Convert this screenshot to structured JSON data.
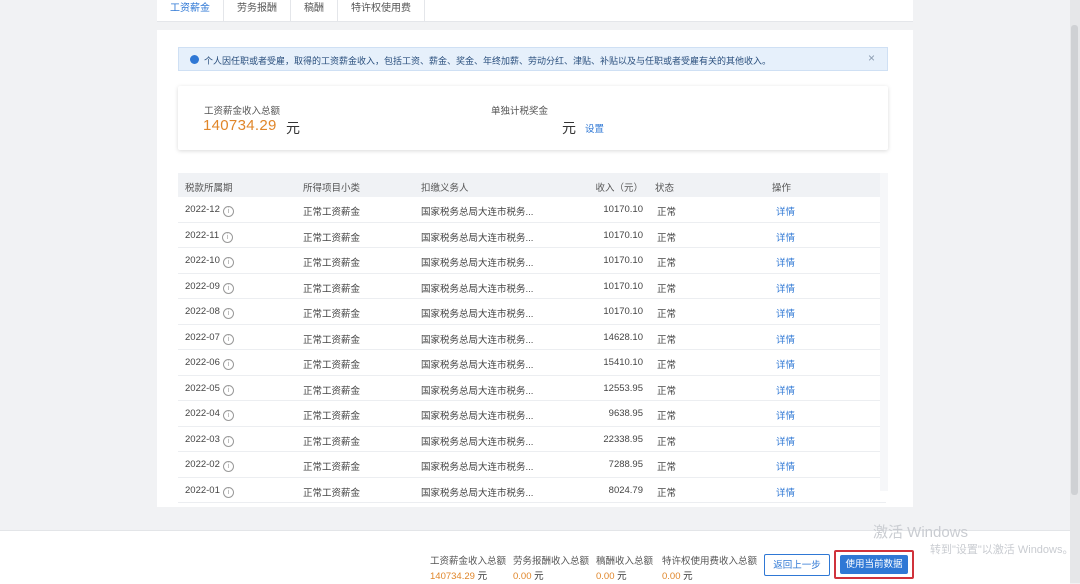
{
  "tabs": [
    "工资薪金",
    "劳务报酬",
    "稿酬",
    "特许权使用费"
  ],
  "notice": {
    "text": "个人因任职或者受雇，取得的工资薪金收入，包括工资、薪金、奖金、年终加薪、劳动分红、津贴、补贴以及与任职或者受雇有关的其他收入。",
    "close": "×"
  },
  "summary": {
    "total_label": "工资薪金收入总额",
    "total_value": "140734.29",
    "total_unit": "元",
    "bonus_label": "单独计税奖金",
    "bonus_unit": "元",
    "bonus_action": "设置"
  },
  "table": {
    "headers": [
      "税款所属期",
      "所得项目小类",
      "扣缴义务人",
      "收入（元）",
      "状态",
      "操作"
    ],
    "rows": [
      {
        "period": "2022-12",
        "item": "正常工资薪金",
        "payer": "国家税务总局大连市税务...",
        "income": "10170.10",
        "status": "正常",
        "op": "详情"
      },
      {
        "period": "2022-11",
        "item": "正常工资薪金",
        "payer": "国家税务总局大连市税务...",
        "income": "10170.10",
        "status": "正常",
        "op": "详情"
      },
      {
        "period": "2022-10",
        "item": "正常工资薪金",
        "payer": "国家税务总局大连市税务...",
        "income": "10170.10",
        "status": "正常",
        "op": "详情"
      },
      {
        "period": "2022-09",
        "item": "正常工资薪金",
        "payer": "国家税务总局大连市税务...",
        "income": "10170.10",
        "status": "正常",
        "op": "详情"
      },
      {
        "period": "2022-08",
        "item": "正常工资薪金",
        "payer": "国家税务总局大连市税务...",
        "income": "10170.10",
        "status": "正常",
        "op": "详情"
      },
      {
        "period": "2022-07",
        "item": "正常工资薪金",
        "payer": "国家税务总局大连市税务...",
        "income": "14628.10",
        "status": "正常",
        "op": "详情"
      },
      {
        "period": "2022-06",
        "item": "正常工资薪金",
        "payer": "国家税务总局大连市税务...",
        "income": "15410.10",
        "status": "正常",
        "op": "详情"
      },
      {
        "period": "2022-05",
        "item": "正常工资薪金",
        "payer": "国家税务总局大连市税务...",
        "income": "12553.95",
        "status": "正常",
        "op": "详情"
      },
      {
        "period": "2022-04",
        "item": "正常工资薪金",
        "payer": "国家税务总局大连市税务...",
        "income": "9638.95",
        "status": "正常",
        "op": "详情"
      },
      {
        "period": "2022-03",
        "item": "正常工资薪金",
        "payer": "国家税务总局大连市税务...",
        "income": "22338.95",
        "status": "正常",
        "op": "详情"
      },
      {
        "period": "2022-02",
        "item": "正常工资薪金",
        "payer": "国家税务总局大连市税务...",
        "income": "7288.95",
        "status": "正常",
        "op": "详情"
      },
      {
        "period": "2022-01",
        "item": "正常工资薪金",
        "payer": "国家税务总局大连市税务...",
        "income": "8024.79",
        "status": "正常",
        "op": "详情"
      }
    ]
  },
  "footer": {
    "items": [
      {
        "label": "工资薪金收入总额",
        "value": "140734.29",
        "unit": "元"
      },
      {
        "label": "劳务报酬收入总额",
        "value": "0.00",
        "unit": "元"
      },
      {
        "label": "稿酬收入总额",
        "value": "0.00",
        "unit": "元"
      },
      {
        "label": "特许权使用费收入总额",
        "value": "0.00",
        "unit": "元"
      }
    ],
    "back_button": "返回上一步",
    "use_button": "使用当前数据",
    "watermark_title": "激活 Windows",
    "watermark_sub": "转到\"设置\"以激活 Windows。"
  },
  "colors": {
    "accent": "#2f78d5",
    "amount": "#e0862a",
    "highlight": "#d0323b"
  }
}
